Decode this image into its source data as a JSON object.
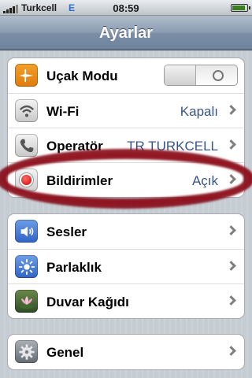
{
  "status_bar": {
    "carrier": "Turkcell",
    "network": "E",
    "time": "08:59"
  },
  "nav": {
    "title": "Ayarlar"
  },
  "groups": [
    {
      "rows": [
        {
          "label": "Uçak Modu",
          "icon": "airplane-icon",
          "control": "toggle",
          "toggle_on": false
        },
        {
          "label": "Wi-Fi",
          "icon": "wifi-icon",
          "value": "Kapalı"
        },
        {
          "label": "Operatör",
          "icon": "phone-icon",
          "value": "TR TURKCELL"
        },
        {
          "label": "Bildirimler",
          "icon": "notifications-icon",
          "value": "Açık"
        }
      ]
    },
    {
      "rows": [
        {
          "label": "Sesler",
          "icon": "speaker-icon"
        },
        {
          "label": "Parlaklık",
          "icon": "brightness-icon"
        },
        {
          "label": "Duvar Kağıdı",
          "icon": "wallpaper-icon"
        }
      ]
    },
    {
      "rows": [
        {
          "label": "Genel",
          "icon": "gear-icon"
        }
      ]
    }
  ],
  "colors": {
    "nav_bar": "#7b8ea6",
    "value_text": "#385487",
    "highlight": "#820612"
  }
}
